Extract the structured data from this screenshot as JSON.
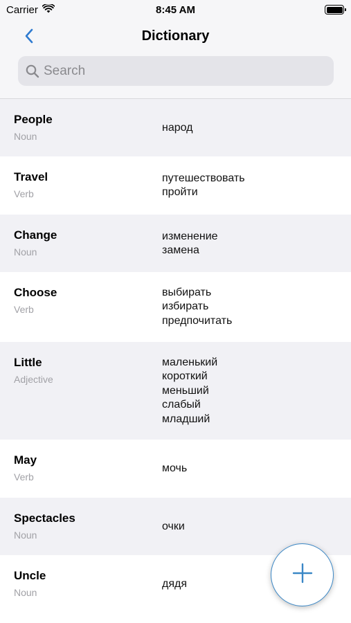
{
  "status_bar": {
    "carrier": "Carrier",
    "time": "8:45 AM",
    "icons": [
      "wifi-icon",
      "battery-icon"
    ]
  },
  "nav": {
    "back_icon": "chevron-left-icon",
    "title": "Dictionary",
    "accent_color": "#2f7bd0"
  },
  "search": {
    "placeholder": "Search",
    "value": "",
    "icon": "magnifier-icon"
  },
  "entries": [
    {
      "word": "People",
      "pos": "Noun",
      "translations": [
        "народ"
      ]
    },
    {
      "word": "Travel",
      "pos": "Verb",
      "translations": [
        "путешествовать",
        "пройти"
      ]
    },
    {
      "word": "Change",
      "pos": "Noun",
      "translations": [
        "изменение",
        "замена"
      ]
    },
    {
      "word": "Choose",
      "pos": "Verb",
      "translations": [
        "выбирать",
        "избирать",
        "предпочитать"
      ]
    },
    {
      "word": "Little",
      "pos": "Adjective",
      "translations": [
        "маленький",
        "короткий",
        "меньший",
        "слабый",
        "младший"
      ]
    },
    {
      "word": "May",
      "pos": "Verb",
      "translations": [
        "мочь"
      ]
    },
    {
      "word": "Spectacles",
      "pos": "Noun",
      "translations": [
        "очки"
      ]
    },
    {
      "word": "Uncle",
      "pos": "Noun",
      "translations": [
        "дядя"
      ]
    }
  ],
  "fab": {
    "icon": "plus-icon",
    "color": "#3a87c6"
  },
  "colors": {
    "row_shaded": "#f1f1f5",
    "row_plain": "#ffffff",
    "secondary_text": "#a1a1a6"
  }
}
